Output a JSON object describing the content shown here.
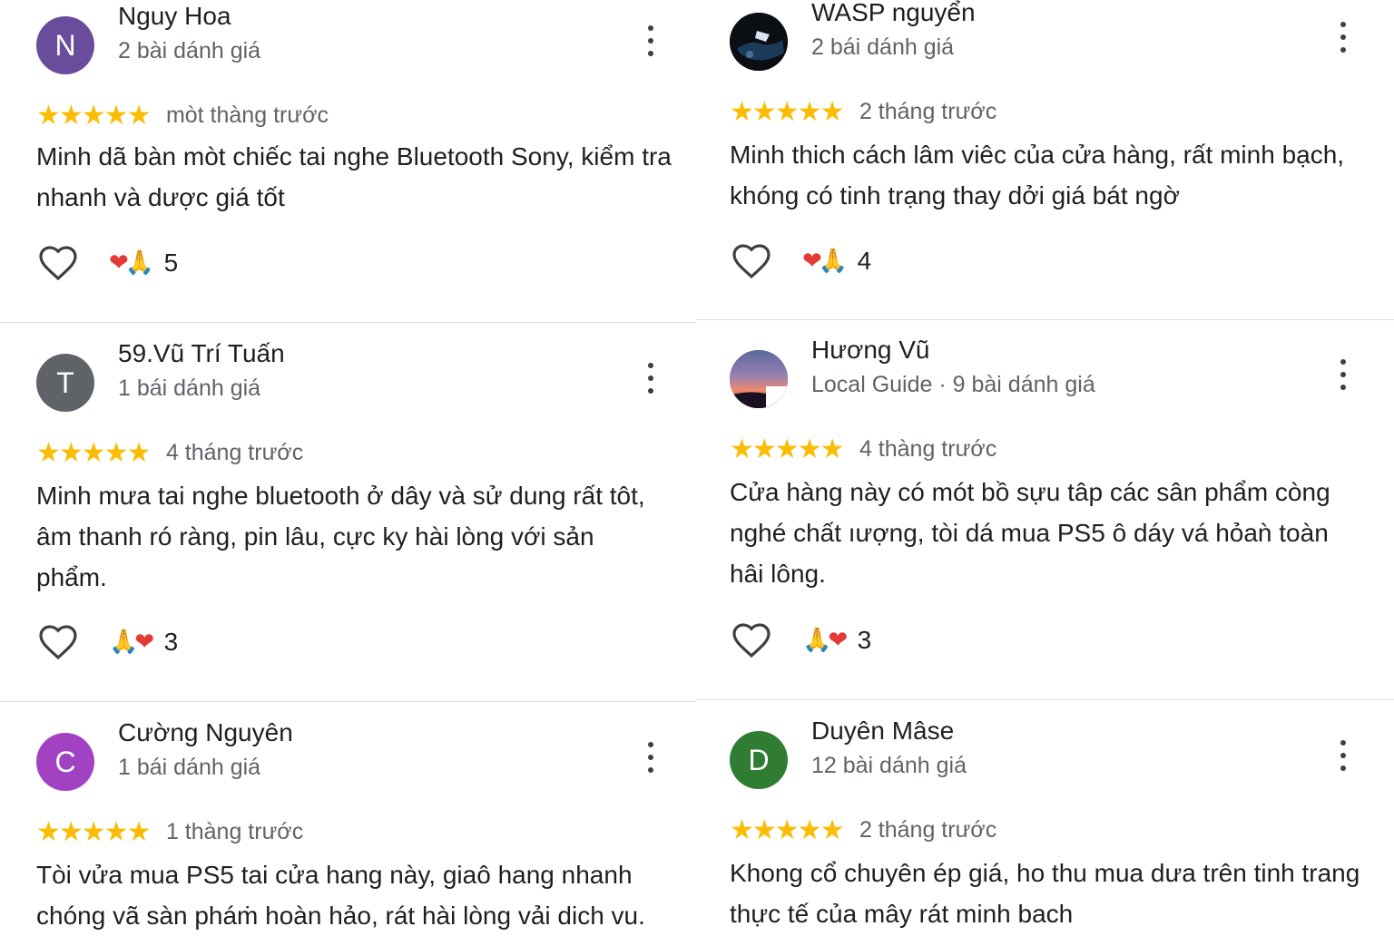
{
  "reviews": [
    {
      "name": "Nguy Hoa",
      "avatar_letter": "N",
      "avatar_color": "#6a4c9c",
      "meta": "2 bài dánh giá",
      "stars": "★★★★★",
      "when": "mòt thàng trước",
      "text": "Minh dã bàn mòt chiếc tai nghe Bluetooth Sony, kiểm tra nhanh và dược giá tốt",
      "reactions": "5"
    },
    {
      "name": "WASP nguyển",
      "avatar_image": "dark-photo-avatar",
      "meta": "2 bái dánh giá",
      "stars": "★★★★★",
      "when": "2 tháng trước",
      "text": "Minh thich cách lâm viêc của cửa hàng, rất minh bạch, khóng có tinh trạng thay dởi giá bát ngờ",
      "reactions": "4"
    },
    {
      "name": "59.Vũ Trí Tuấn",
      "avatar_letter": "T",
      "avatar_color": "#5f6368",
      "meta": "1 bái dánh giá",
      "stars": "★★★★★",
      "when": "4 tháng trước",
      "text": "Minh mưa tai nghe bluetooth ở dây và sử dung rất tôt, âm thanh ró ràng, pin lâu, cực ky hài lòng với sản phẩm.",
      "reactions": "3"
    },
    {
      "name": "Hương Vũ",
      "avatar_image": "sunset-photo-avatar",
      "meta": "Local Guide · 9 bài dánh giá",
      "stars": "★★★★★",
      "when": "4 thàng trước",
      "text": "Cửa hàng này có mót bồ sựu tâp các sân phẩm còng nghé chất ıượng, tòi dá mua PS5 ô dáy vá hỏaǹ toàn hâi lông.",
      "reactions": "3"
    },
    {
      "name": "Cường Nguyên",
      "avatar_letter": "C",
      "avatar_color": "#a142c2",
      "meta": "1 bái dánh giá",
      "stars": "★★★★★",
      "when": "1 thàng trước",
      "text": "Tòi vửa mua PS5 tai cửa hang này, giaô hang nhanh chóng vã sàn pháṁ hoàn hảo, rát hài lòng vải dich vu.",
      "reactions": ""
    },
    {
      "name": "Duyên Mâse",
      "avatar_letter": "D",
      "avatar_color": "#2e7d32",
      "meta": "12 bài dánh giá",
      "stars": "★★★★★",
      "when": "2 tháng trước",
      "text": "Khong cổ chuyên ép giá, ho thu mua dưa trên tinh trang thực tế của mây rát minh bach",
      "reactions": ""
    }
  ]
}
